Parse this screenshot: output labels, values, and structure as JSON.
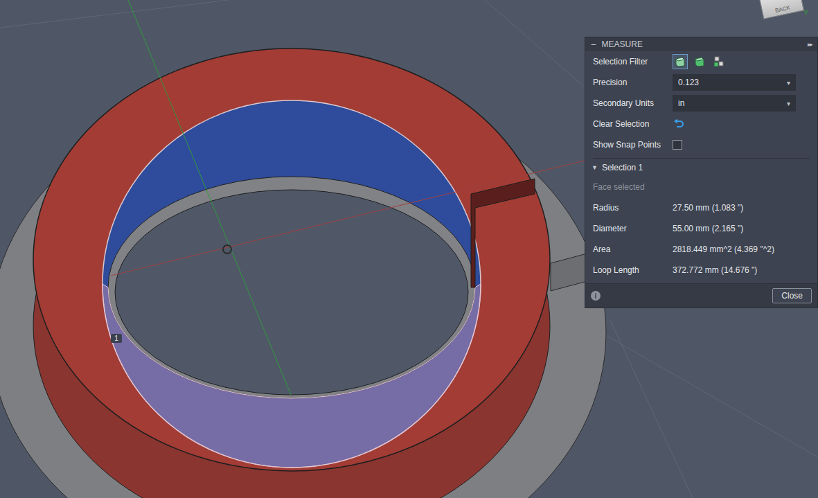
{
  "viewcube": {
    "label": "BACK",
    "axis": "Y"
  },
  "marker": {
    "label": "1"
  },
  "panel": {
    "title": "MEASURE",
    "collapse_glyph": "−",
    "expand_glyph": "▸▸",
    "selection_filter": {
      "label": "Selection Filter",
      "options": [
        {
          "kind": "body",
          "selected": true
        },
        {
          "kind": "face",
          "selected": false
        },
        {
          "kind": "component",
          "selected": false
        }
      ]
    },
    "precision": {
      "label": "Precision",
      "value": "0.123",
      "dropdown_glyph": "▾"
    },
    "secondary_units": {
      "label": "Secondary Units",
      "value": "in",
      "dropdown_glyph": "▾"
    },
    "clear_selection": {
      "label": "Clear Selection"
    },
    "show_snap_points": {
      "label": "Show Snap Points",
      "checked": false
    },
    "selection": {
      "title": "Selection 1",
      "expanded": true,
      "expand_glyph": "▼",
      "status": "Face selected",
      "measurements": [
        {
          "label": "Radius",
          "value": "27.50 mm (1.083 \")"
        },
        {
          "label": "Diameter",
          "value": "55.00 mm (2.165 \")"
        },
        {
          "label": "Area",
          "value": "2818.449 mm^2 (4.369 \"^2)"
        },
        {
          "label": "Loop Length",
          "value": "372.772 mm (14.676 \")"
        }
      ]
    },
    "info_glyph": "i",
    "close_button": "Close"
  }
}
